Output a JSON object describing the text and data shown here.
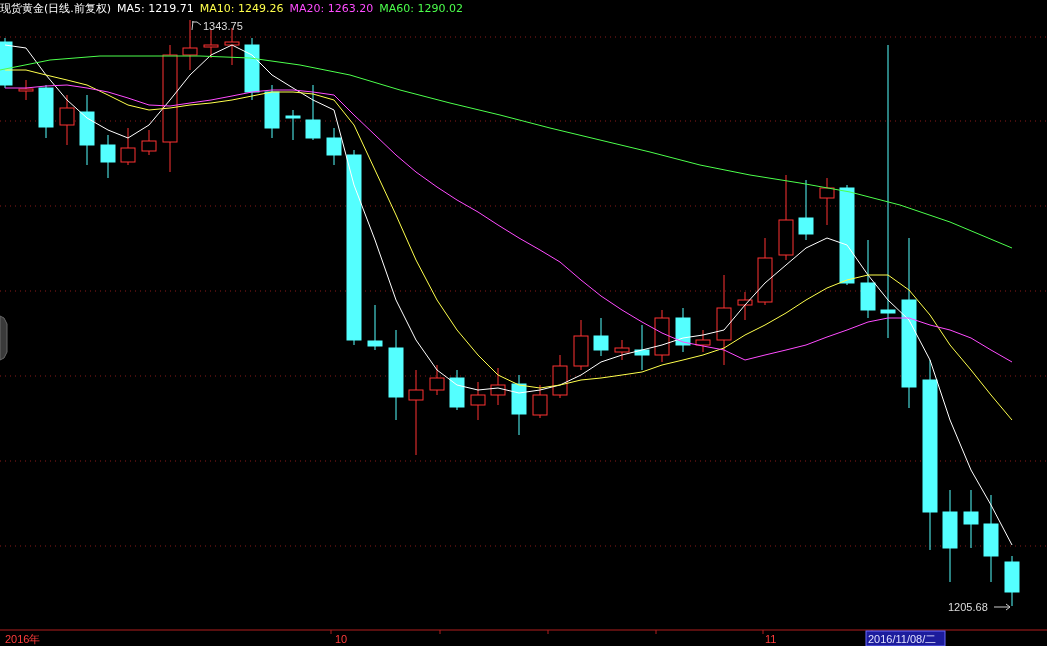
{
  "title": "现货黄金(日线.前复权)",
  "indicators": [
    {
      "label": "MA5: 1219.71",
      "color": "#ffffff"
    },
    {
      "label": "MA10: 1249.26",
      "color": "#ffff4c"
    },
    {
      "label": "MA20: 1263.20",
      "color": "#ff4cff"
    },
    {
      "label": "MA60: 1290.02",
      "color": "#4cff4c"
    }
  ],
  "high_marker": "1343.75",
  "low_marker": "1205.68",
  "x_axis": {
    "labels": [
      "2016年",
      "10",
      "11"
    ],
    "cursor_date": "2016/11/08/二"
  }
}
